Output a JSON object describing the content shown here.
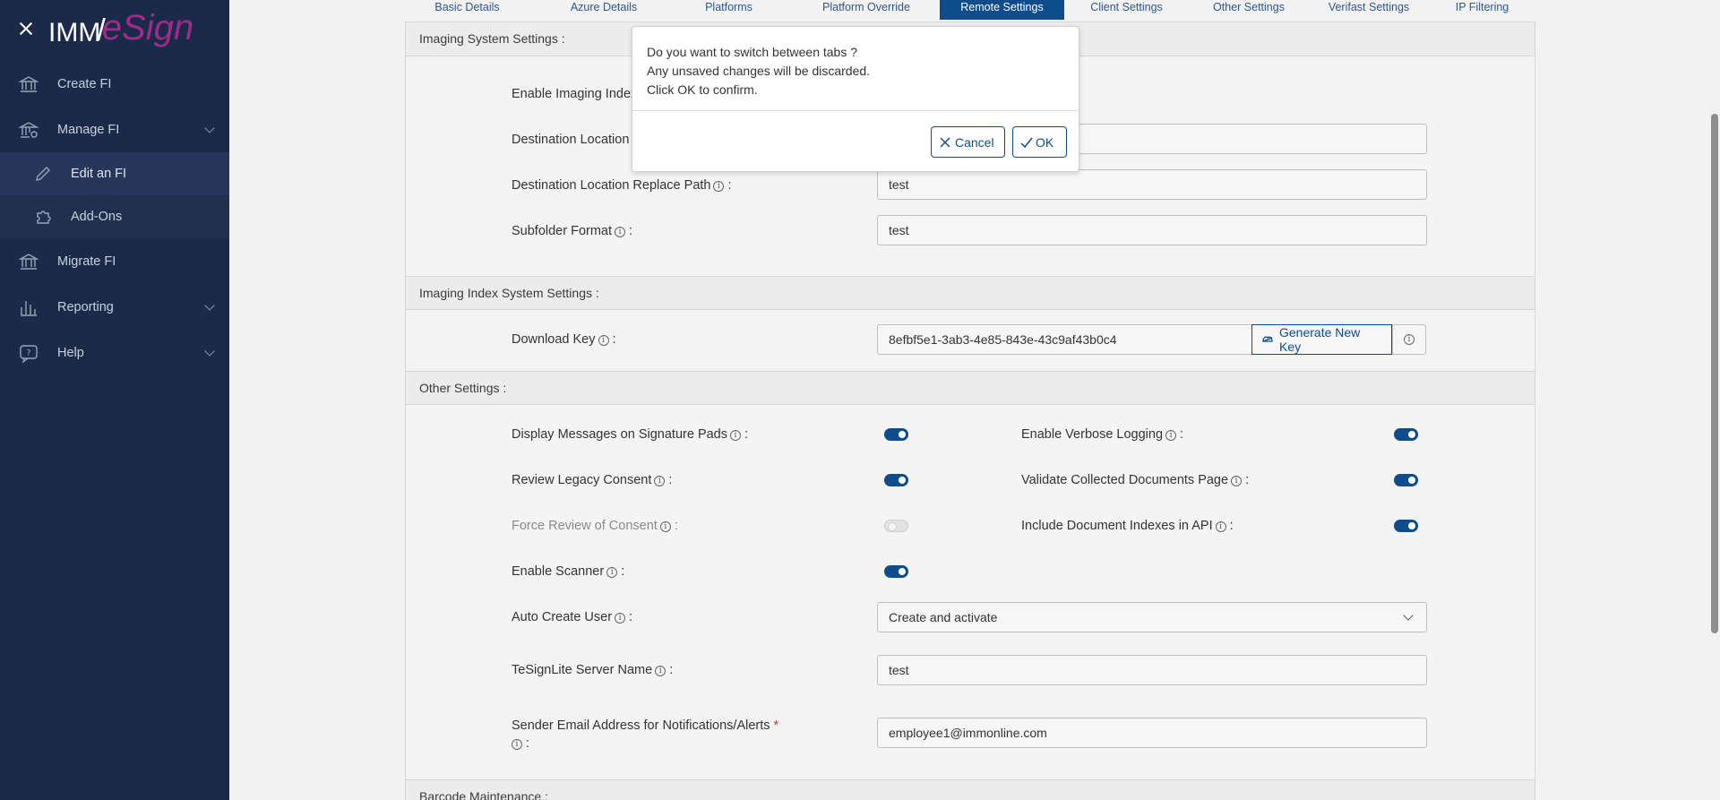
{
  "brand": {
    "part1": "IMM",
    "part2": "/",
    "part3": "eSign"
  },
  "sidebar": {
    "items": [
      {
        "label": "Create FI",
        "icon": "bank-icon"
      },
      {
        "label": "Manage FI",
        "icon": "bank-gear-icon"
      },
      {
        "label": "Edit an FI",
        "icon": "pencil-icon"
      },
      {
        "label": "Add-Ons",
        "icon": "puzzle-icon"
      },
      {
        "label": "Migrate FI",
        "icon": "bank-icon"
      },
      {
        "label": "Reporting",
        "icon": "bar-chart-icon"
      },
      {
        "label": "Help",
        "icon": "help-icon"
      }
    ]
  },
  "tabs": [
    {
      "label": "Basic Details"
    },
    {
      "label": "Azure Details"
    },
    {
      "label": "Platforms"
    },
    {
      "label": "Platform Override"
    },
    {
      "label": "Remote Settings",
      "active": true
    },
    {
      "label": "Client Settings"
    },
    {
      "label": "Other Settings"
    },
    {
      "label": "Verifast Settings"
    },
    {
      "label": "IP Filtering"
    }
  ],
  "imaging": {
    "header": "Imaging System Settings :",
    "enable_index_label": "Enable Imaging Index",
    "dest_location_label": "Destination Location",
    "replace_path_label": "Destination Location Replace Path",
    "replace_path_value": "test",
    "subfolder_label": "Subfolder Format",
    "subfolder_value": "test"
  },
  "index_system": {
    "header": "Imaging Index System Settings :",
    "download_key_label": "Download Key",
    "download_key_value": "8efbf5e1-3ab3-4e85-843e-43c9af43b0c4",
    "generate_label": "Generate New Key"
  },
  "other": {
    "header": "Other Settings :",
    "display_messages_label": "Display Messages on Signature Pads",
    "verbose_label": "Enable Verbose Logging",
    "legacy_label": "Review Legacy Consent",
    "validate_label": "Validate Collected Documents Page",
    "force_review_label": "Force Review of Consent",
    "include_indexes_label": "Include Document Indexes in API",
    "scanner_label": "Enable Scanner",
    "auto_create_label": "Auto Create User",
    "auto_create_value": "Create and activate",
    "server_name_label": "TeSignLite Server Name",
    "server_name_value": "test",
    "sender_email_label": "Sender Email Address for Notifications/Alerts",
    "sender_email_value": "employee1@immonline.com"
  },
  "barcode": {
    "header": "Barcode Maintenance :"
  },
  "modal": {
    "line1": "Do you want to switch between tabs ?",
    "line2": "Any unsaved changes will be discarded.",
    "line3": "Click OK to confirm.",
    "cancel_label": "Cancel",
    "ok_label": "OK"
  },
  "colors": {
    "sidebar_bg": "#1c2a4a",
    "accent": "#0e4c8c",
    "brand_magenta": "#9b2c8a"
  }
}
